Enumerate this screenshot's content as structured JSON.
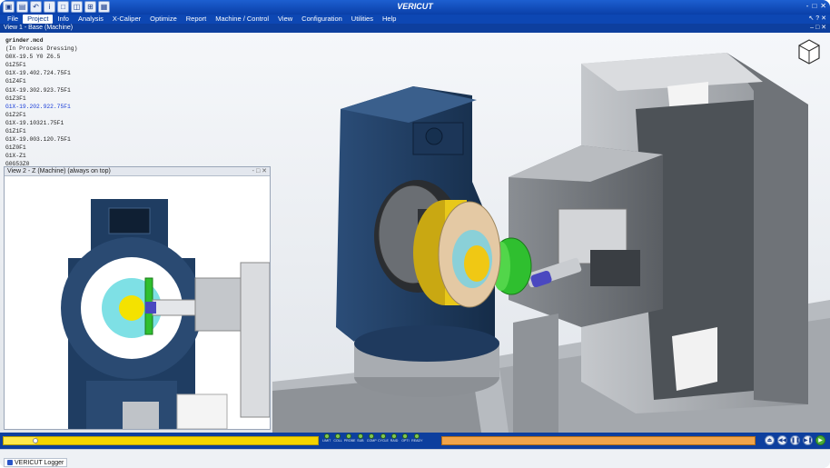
{
  "app": {
    "title": "VERICUT",
    "quick_access": [
      "folder-icon",
      "open-file-icon",
      "undo-icon",
      "tools-icon",
      "info-icon",
      "dropdown-icon",
      "layout-single-icon",
      "layout-split-icon",
      "layout-quad-icon",
      "save-image-icon"
    ],
    "window_controls": [
      "‐",
      "□",
      "✕"
    ]
  },
  "menu": {
    "items": [
      "File",
      "Project",
      "Info",
      "Analysis",
      "X-Caliper",
      "Optimize",
      "Report",
      "Machine / Control",
      "View",
      "Configuration",
      "Utilities",
      "Help"
    ],
    "active": "Project",
    "right_controls": "↖ ? ✕"
  },
  "view1": {
    "title": "View 1 - Base (Machine)",
    "controls": "– □ ✕"
  },
  "nc_program": {
    "filename": "grinder.mcd",
    "lines": [
      "(In Process Dressing)",
      "G0X-19.5 Y0 Z6.5",
      "G1Z5F1",
      "G1X-19.402.724.75F1",
      "G1Z4F1",
      "G1X-19.302.923.75F1",
      "G1Z3F1",
      "G1X-19.202.922.75F1",
      "G1Z2F1",
      "G1X-19.10321.75F1",
      "G1Z1F1",
      "G1X-19.003.120.75F1",
      "G1Z0F1",
      "G1X-Z1",
      "G0G53Z0"
    ],
    "highlighted_line": 7
  },
  "view2": {
    "title": "View 2 - Z (Machine) (always on top)",
    "controls": "‐ □ ✕"
  },
  "controls": {
    "progress": 0.1,
    "leds": [
      {
        "label": "LIMIT",
        "color": "#7fc652"
      },
      {
        "label": "COLL",
        "color": "#7fc652"
      },
      {
        "label": "PROBE",
        "color": "#7fc652"
      },
      {
        "label": "SUB",
        "color": "#7fc652"
      },
      {
        "label": "COMP",
        "color": "#7fc652"
      },
      {
        "label": "CYCLE",
        "color": "#7fc652"
      },
      {
        "label": "RAID",
        "color": "#7fc652"
      },
      {
        "label": "OPTI",
        "color": "#7fc652"
      },
      {
        "label": "READY",
        "color": "#7fc652"
      }
    ],
    "playback_buttons": [
      "reset-icon",
      "rewind-icon",
      "pause-icon",
      "step-icon",
      "play-icon"
    ]
  },
  "status": {
    "logger_label": "VERICUT Logger"
  },
  "colors": {
    "titlebar": "#0a3fa8",
    "menubar": "#0d47b3",
    "progress": "#f4d400",
    "secondary_bar": "#f0a44a",
    "machine_blue": "#1f3d62",
    "grinding_wheel": "#e8c81a",
    "dresser_green": "#2fbf2f",
    "hub_cyan": "#3fc1c4"
  }
}
